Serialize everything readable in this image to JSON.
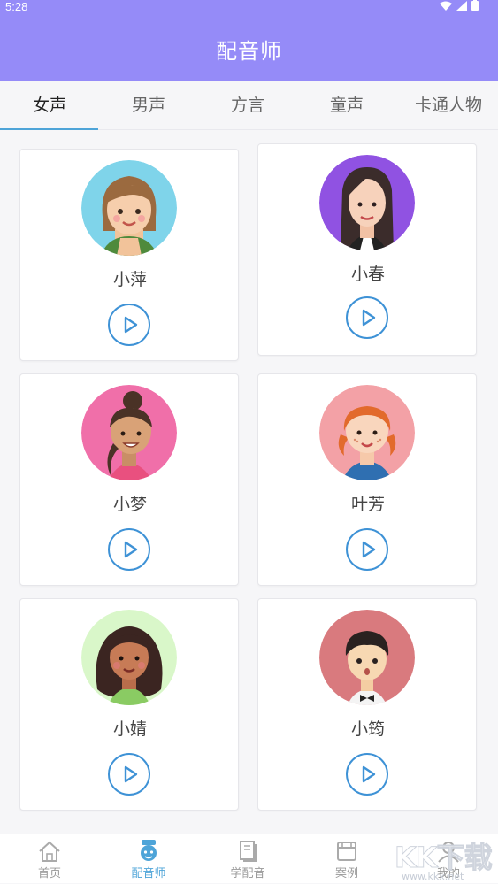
{
  "status_bar": {
    "time": "5:28"
  },
  "header": {
    "title": "配音师"
  },
  "tabs": [
    {
      "label": "女声",
      "active": true
    },
    {
      "label": "男声",
      "active": false
    },
    {
      "label": "方言",
      "active": false
    },
    {
      "label": "童声",
      "active": false
    },
    {
      "label": "卡通人物",
      "active": false
    }
  ],
  "voices": [
    {
      "name": "小萍",
      "avatar_bg": "#7fd4ea",
      "icon": "woman-brown-hair-avatar"
    },
    {
      "name": "小春",
      "avatar_bg": "#9052e2",
      "icon": "woman-long-dark-hair-avatar"
    },
    {
      "name": "小梦",
      "avatar_bg": "#f06fa9",
      "icon": "woman-bun-hair-avatar"
    },
    {
      "name": "叶芳",
      "avatar_bg": "#f3a1a6",
      "icon": "girl-red-braids-avatar"
    },
    {
      "name": "小婧",
      "avatar_bg": "#d9f7c9",
      "icon": "woman-curly-hair-avatar"
    },
    {
      "name": "小筠",
      "avatar_bg": "#d97a7e",
      "icon": "boy-bowtie-avatar"
    }
  ],
  "bottom_nav": [
    {
      "label": "首页",
      "icon": "home-icon",
      "active": false
    },
    {
      "label": "配音师",
      "icon": "voice-actor-icon",
      "active": true
    },
    {
      "label": "学配音",
      "icon": "book-icon",
      "active": false
    },
    {
      "label": "案例",
      "icon": "cases-icon",
      "active": false
    },
    {
      "label": "我的",
      "icon": "profile-icon",
      "active": false
    }
  ],
  "watermark": {
    "text": "KK下载",
    "url": "www.kkx.net"
  },
  "colors": {
    "header": "#958bf8",
    "accent": "#4ea4d8",
    "play": "#3e92d6"
  }
}
